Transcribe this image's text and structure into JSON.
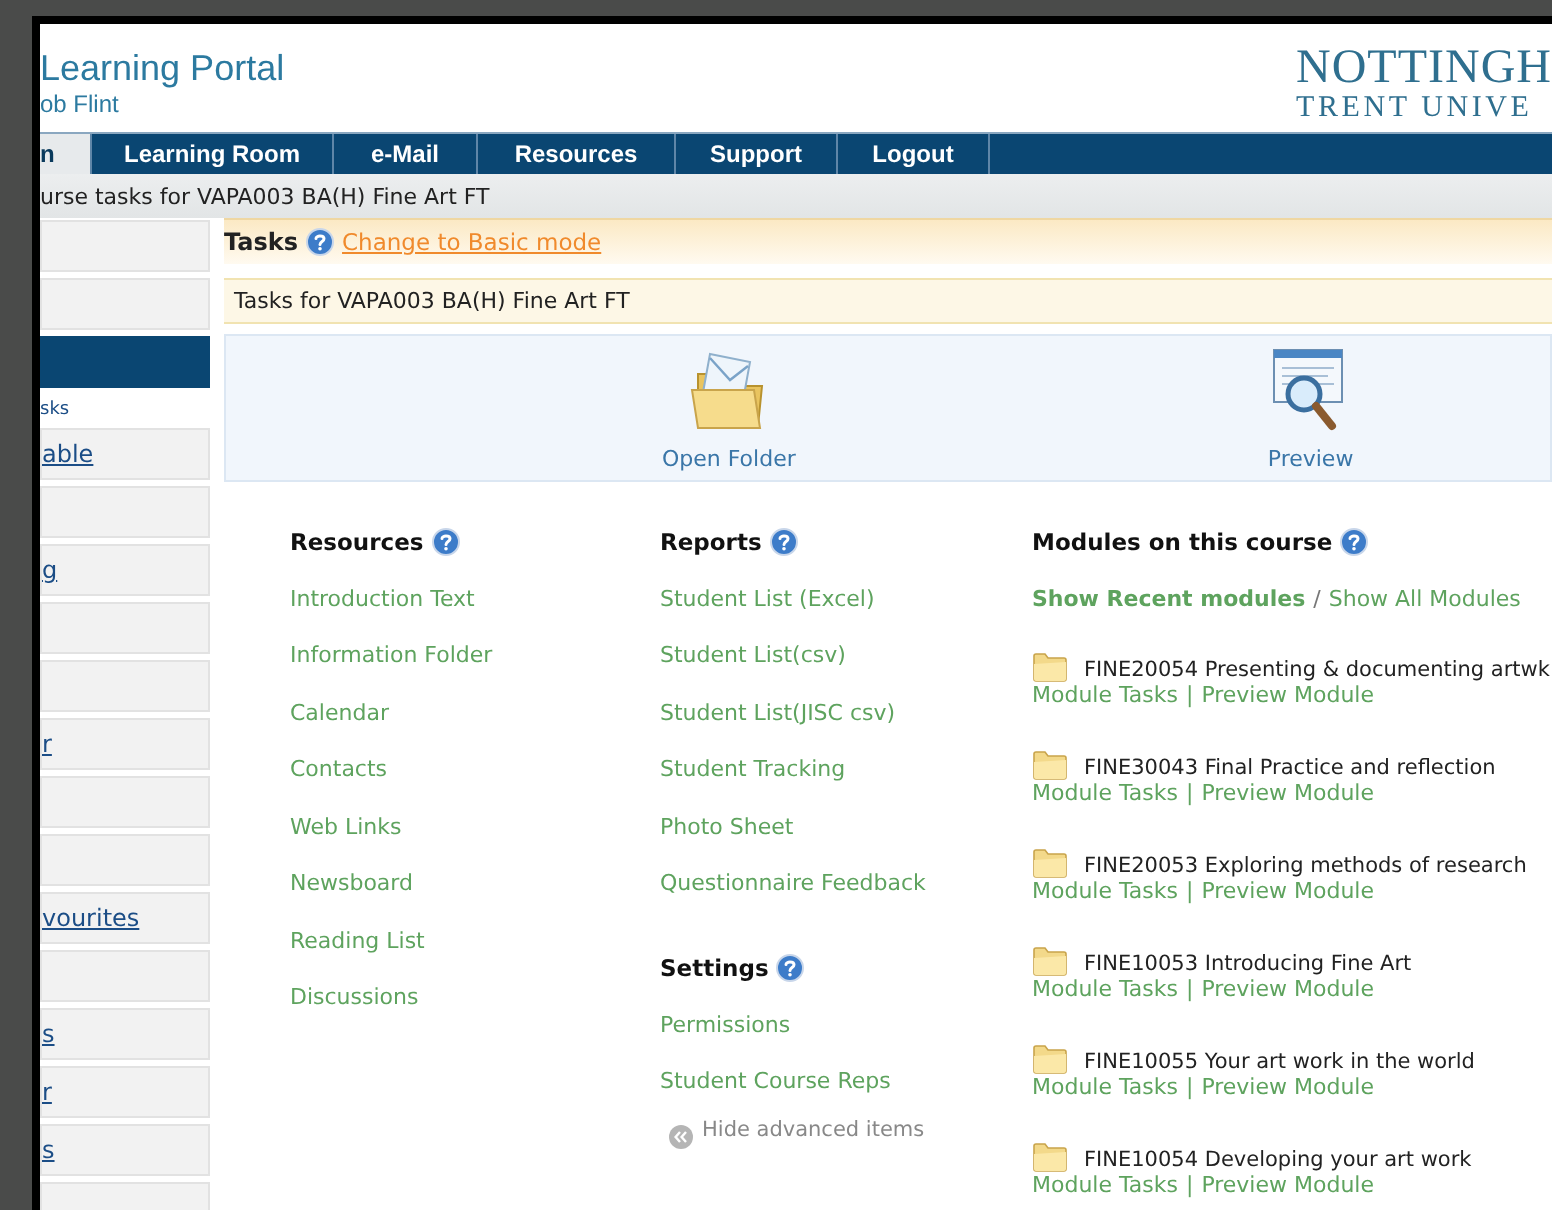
{
  "header": {
    "title": "Learning Portal",
    "user": "ob Flint",
    "logo_lines": [
      "NOTTINGH",
      "TRENT UNIVE"
    ]
  },
  "nav": [
    {
      "label": "n",
      "selected": true
    },
    {
      "label": "Learning Room",
      "selected": false
    },
    {
      "label": "e-Mail",
      "selected": false
    },
    {
      "label": "Resources",
      "selected": false
    },
    {
      "label": "Support",
      "selected": false
    },
    {
      "label": "Logout",
      "selected": false
    }
  ],
  "breadcrumb": "urse tasks for VAPA003 BA(H) Fine Art FT",
  "sidebar": {
    "items": [
      {
        "kind": "box",
        "selected": false
      },
      {
        "kind": "box",
        "selected": false
      },
      {
        "kind": "box",
        "selected": true
      },
      {
        "kind": "heading",
        "label": "sks"
      },
      {
        "kind": "box",
        "selected": false,
        "label": "able"
      },
      {
        "kind": "box",
        "selected": false
      },
      {
        "kind": "box",
        "selected": false,
        "label": "g"
      },
      {
        "kind": "box",
        "selected": false
      },
      {
        "kind": "box",
        "selected": false
      },
      {
        "kind": "box",
        "selected": false,
        "label": "r"
      },
      {
        "kind": "box",
        "selected": false
      },
      {
        "kind": "box",
        "selected": false
      },
      {
        "kind": "box",
        "selected": false,
        "label": "vourites"
      },
      {
        "kind": "box",
        "selected": false
      },
      {
        "kind": "box",
        "selected": false,
        "label": "s"
      },
      {
        "kind": "box",
        "selected": false,
        "label": "r"
      },
      {
        "kind": "box",
        "selected": false,
        "label": "s"
      },
      {
        "kind": "box",
        "selected": false
      }
    ]
  },
  "tasks": {
    "title": "Tasks",
    "mode_link": "Change to Basic mode",
    "caption": "Tasks for VAPA003 BA(H) Fine Art FT"
  },
  "toolbar": [
    {
      "kind": "open-folder",
      "label": "Open Folder"
    },
    {
      "kind": "preview",
      "label": "Preview"
    }
  ],
  "resources": {
    "heading": "Resources",
    "links": [
      "Introduction Text",
      "Information Folder",
      "Calendar",
      "Contacts",
      "Web Links",
      "Newsboard",
      "Reading List",
      "Discussions"
    ]
  },
  "reports": {
    "heading": "Reports",
    "links": [
      "Student List (Excel)",
      "Student List(csv)",
      "Student List(JISC csv)",
      "Student Tracking",
      "Photo Sheet",
      "Questionnaire Feedback"
    ]
  },
  "settings": {
    "heading": "Settings",
    "links": [
      "Permissions",
      "Student Course Reps"
    ],
    "hide_link": "Hide advanced items"
  },
  "modules": {
    "heading": "Modules on this course",
    "filters": [
      {
        "label": "Show Recent modules",
        "selected": true
      },
      {
        "label": "Show All Modules",
        "selected": false
      }
    ],
    "filter_separator": "/",
    "items": [
      {
        "name": "FINE20054 Presenting & documenting artwk",
        "tasks": "Module Tasks",
        "separator": "|",
        "preview": "Preview Module"
      },
      {
        "name": "FINE30043 Final Practice and reflection",
        "tasks": "Module Tasks",
        "separator": "|",
        "preview": "Preview Module"
      },
      {
        "name": "FINE20053 Exploring methods of research",
        "tasks": "Module Tasks",
        "separator": "|",
        "preview": "Preview Module"
      },
      {
        "name": "FINE10053 Introducing Fine Art",
        "tasks": "Module Tasks",
        "separator": "|",
        "preview": "Preview Module"
      },
      {
        "name": "FINE10055 Your art work in the world",
        "tasks": "Module Tasks",
        "separator": "|",
        "preview": "Preview Module"
      },
      {
        "name": "FINE10054 Developing your art work",
        "tasks": "Module Tasks",
        "separator": "|",
        "preview": "Preview Module"
      }
    ]
  }
}
